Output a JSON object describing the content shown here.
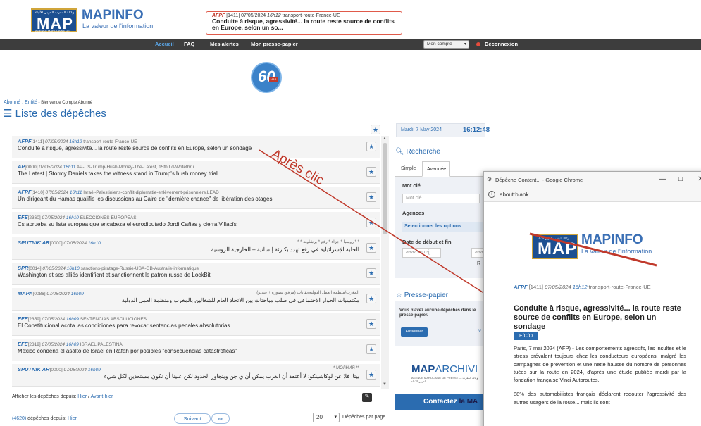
{
  "header": {
    "logo_arabic": "وكالة المغرب العربي للأنباء",
    "logo_map": "MAP",
    "logo_sub": "AGENCE MAROCAINE DE PRESSE",
    "brand": "MAPINFO",
    "tagline": "La valeur de l'information",
    "breaking": {
      "agency": "AFPF",
      "id": "[1411]",
      "date": "07/05/2024",
      "time": "16h12",
      "tag": "transport-route-France-UE",
      "title": "Conduite à risque, agressivité... la route reste source de conflits en Europe, selon un so..."
    }
  },
  "nav": {
    "items": [
      "Accueil",
      "FAQ",
      "Mes alertes",
      "Mon presse-papier"
    ],
    "account": "Mon compte",
    "logout": "Déconnexion"
  },
  "emblem": {
    "number": "60",
    "badge": "MAP"
  },
  "breadcrumb": {
    "abonne": "Abonné : Entité",
    "welcome": " - Bienvenue Compte Abonné"
  },
  "page_title": "Liste des dépêches",
  "dispatches": [
    {
      "agency": "AFPF",
      "id": "[1411]",
      "date": "07/05/2024",
      "time": "16h12",
      "tag": "transport-route-France-UE",
      "title": "Conduite à risque, agressivité... la route reste source de conflits en Europe, selon un sondage",
      "rtl": false,
      "underline": true
    },
    {
      "agency": "AP",
      "id": "[0000]",
      "date": "07/05/2024",
      "time": "16h11",
      "tag": "AP-US-Trump-Hush-Money-The-Latest, 15th Ld-Writethru",
      "title": "The Latest | Stormy Daniels takes the witness stand in Trump's hush money trial",
      "rtl": false,
      "underline": false
    },
    {
      "agency": "AFPF",
      "id": "[1410]",
      "date": "07/05/2024",
      "time": "16h11",
      "tag": "Israël-Palestiniens-conflit-diplomatie-enlèvement-prisonniers,LEAD",
      "title": "Un dirigeant du Hamas qualifie les discussions au Caire de \"dernière chance\" de libération des otages",
      "rtl": false,
      "underline": false
    },
    {
      "agency": "EFE",
      "id": "[2360]",
      "date": "07/05/2024",
      "time": "16h10",
      "tag": "ELECCIONES EUROPEAS",
      "title": "Cs aprueba su lista europea que encabeza el eurodiputado Jordi Cañas y cierra Villacís",
      "rtl": false,
      "underline": false
    },
    {
      "agency": "SPUTNIK AR",
      "id": "[0000]",
      "date": "07/05/2024",
      "time": "16h10",
      "tag": "* * روسيا * جزاء * رفع * برشلونة * *",
      "title": "الحلبة الإسرائيلية في رفع تهدد بكارثة إنسانية – الخارجية الروسية",
      "rtl": true,
      "underline": false
    },
    {
      "agency": "SPR",
      "id": "[0014]",
      "date": "07/05/2024",
      "time": "16h10",
      "tag": "sanctions-piratage-Russie-USA-GB-Australie-informatique",
      "title": "Washington et ses alliés identifient et sanctionnent le patron russe de LockBit",
      "rtl": false,
      "underline": false
    },
    {
      "agency": "MAPA",
      "id": "[0086]",
      "date": "07/05/2024",
      "time": "16h09",
      "tag": "المغرب/منظمة العمل الدولية/نقابات (مرفق بصورة + فيديو)",
      "title": "مكتسبات الحوار الاجتماعي في صلب مباحثات بين الاتحاد العام للشغالين بالمغرب ومنظمة العمل الدولية",
      "rtl": true,
      "underline": false
    },
    {
      "agency": "EFE",
      "id": "[2359]",
      "date": "07/05/2024",
      "time": "16h09",
      "tag": "SENTENCIAS ABSOLUCIONES",
      "title": "El Constitucional acota las condiciones para revocar sentencias penales absolutorias",
      "rtl": false,
      "underline": false
    },
    {
      "agency": "EFE",
      "id": "[2319]",
      "date": "07/05/2024",
      "time": "16h09",
      "tag": "ISRAEL PALESTINA",
      "title": "México condena el asalto de Israel en Rafah por posibles \"consecuencias catastróficas\"",
      "rtl": false,
      "underline": false
    },
    {
      "agency": "SPUTNIK AR",
      "id": "[0000]",
      "date": "07/05/2024",
      "time": "16h09",
      "tag": "** МОЛНИЯ *",
      "title": "بيتا: فلا عن لوكاشينكو: لا أعتقد أن الغرب يمكن أن ي جن ويتجاوز الحدود لكن علينا أن نكون مستعدين لكل شيء",
      "rtl": true,
      "underline": false
    }
  ],
  "afficher": {
    "label": "Afficher les dépêches depuis:",
    "hier": "Hier",
    "sep": " / ",
    "avant_hier": "Avant-hier"
  },
  "footer": {
    "count": "(4620)",
    "count_label": " dépêches depuis: ",
    "hier": "Hier",
    "suivant": "Suivant",
    "next": "»»",
    "per_page_value": "20",
    "per_page_label": "Dépêches par page"
  },
  "sidebar": {
    "date": "Mardi, 7 May 2024",
    "time": "16:12:48",
    "recherche": "Recherche",
    "tab_simple": "Simple",
    "tab_avancee": "Avancée",
    "mot_cle_label": "Mot clé",
    "mot_cle_placeholder": "Mot clé",
    "agences_label": "Agences",
    "agences_select": "Selectionner les options",
    "dates_label": "Date de début et fin",
    "date_placeholder": "aaaa-mm-jj",
    "date_placeholder2": "aaa",
    "r_btn": "R",
    "presse": "Presse-papier",
    "presse_msg": "Vous n'avez aucune dépêches dans le presse-papier.",
    "fusionner": "Fusionner",
    "v": "V",
    "archive_bold": "MAP",
    "archive_light": "ARCHIVI",
    "archive_sub": "AGENCE MAROCAINE DE PRESSE — وكالة المغرب العربي للأنباء",
    "contactez_a": "Contactez",
    "contactez_b": " la MA"
  },
  "annotation": "Après clic",
  "popup": {
    "window_title": "Dépêche Content... - Google Chrome",
    "url": "about:blank",
    "logo_arabic": "وكالة المغرب العربي للأنباء",
    "logo_map": "MAP",
    "brand": "MAPINFO",
    "tagline": "La valeur de l'information",
    "agency": "AFPF",
    "id": "[1411]",
    "date": "07/05/2024",
    "time": "16h12",
    "tag": "transport-route-France-UE",
    "title": "Conduite à risque, agressivité... la route reste source de conflits en Europe, selon un sondage",
    "badge": "E/C/O",
    "body1": "Paris, 7 mai 2024 (AFP) - Les comportements agressifs, les insultes et le stress prévalent toujours chez les conducteurs européens, malgré les campagnes de prévention et une nette hausse du nombre de personnes tuées sur la route en 2024, d'après une étude publiée mardi par la fondation française Vinci Autoroutes.",
    "body2": "88% des automobilistes français déclarent redouter l'agressivité des autres usagers de la route... mais ils sont"
  },
  "colors": {
    "accent": "#2b6cb0",
    "brand_dark": "#1c4f91",
    "annotation": "#c0392b",
    "nav": "#3d3d3d"
  }
}
